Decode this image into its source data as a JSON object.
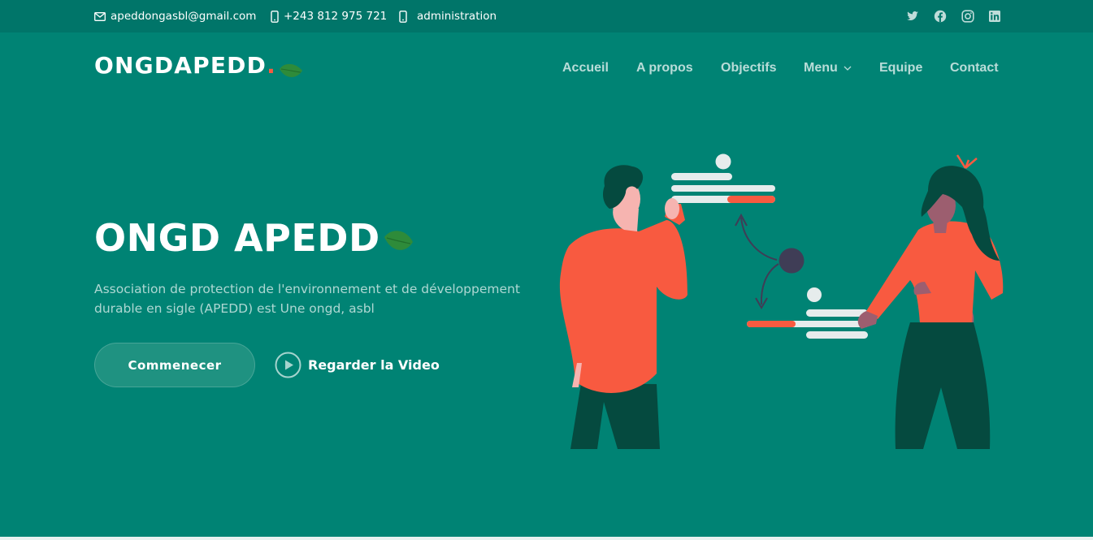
{
  "topbar": {
    "email": "apeddongasbl@gmail.com",
    "phone": "+243 812 975 721",
    "admin": "administration",
    "social_icons": [
      "twitter-icon",
      "facebook-icon",
      "instagram-icon",
      "linkedin-icon"
    ]
  },
  "header": {
    "logo": "ONGDAPEDD",
    "logo_dot": ".",
    "nav": [
      {
        "label": "Accueil"
      },
      {
        "label": "A propos"
      },
      {
        "label": "Objectifs"
      },
      {
        "label": "Menu"
      },
      {
        "label": "Equipe"
      },
      {
        "label": "Contact"
      }
    ]
  },
  "hero": {
    "title": "ONGD APEDD",
    "description": "Association de protection de l'environnement et de développement durable en sigle (APEDD) est Une ongd, asbl",
    "start_button": "Commenecer",
    "video_button": "Regarder la Video"
  },
  "colors": {
    "background": "#008374",
    "topbar": "#007569",
    "accent": "#f85a40",
    "leaf": "#2e8b3a"
  }
}
